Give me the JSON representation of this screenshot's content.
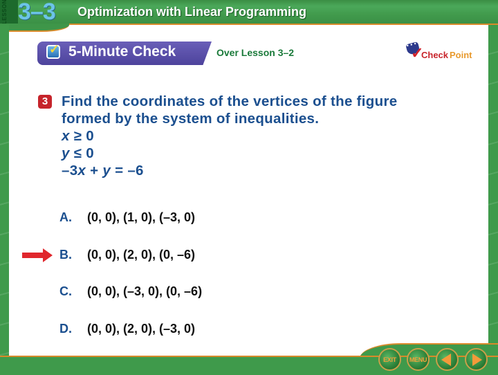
{
  "header": {
    "lesson_word": "LESSON",
    "lesson_number": "3–3",
    "lesson_title": "Optimization with Linear Programming"
  },
  "banner": {
    "title": "5-Minute Check",
    "subtitle": "Over Lesson 3–2",
    "logo_text_a": "Check",
    "logo_text_b": "Point"
  },
  "question": {
    "number": "3",
    "text_line1": "Find the coordinates of the vertices of the figure",
    "text_line2": "formed by the system of inequalities.",
    "equations": [
      {
        "var": "x",
        "rest": " ≥ 0"
      },
      {
        "var": "y",
        "rest": " ≤ 0"
      },
      {
        "pre": "–3",
        "var": "x",
        "mid": " + ",
        "var2": "y",
        "rest": " = –6"
      }
    ]
  },
  "answers": [
    {
      "letter": "A.",
      "text": "(0, 0), (1, 0), (–3, 0)"
    },
    {
      "letter": "B.",
      "text": "(0, 0), (2, 0), (0, –6)"
    },
    {
      "letter": "C.",
      "text": "(0, 0), (–3, 0), (0, –6)"
    },
    {
      "letter": "D.",
      "text": "(0, 0), (2, 0), (–3, 0)"
    }
  ],
  "selected_answer": "B",
  "nav": {
    "exit_label": "EXIT",
    "menu_label": "MENU"
  },
  "colors": {
    "green": "#3f9a4b",
    "orange": "#d88a2a",
    "purple": "#574da6",
    "question_blue": "#1b4f8f",
    "arrow_red": "#e0262c"
  }
}
